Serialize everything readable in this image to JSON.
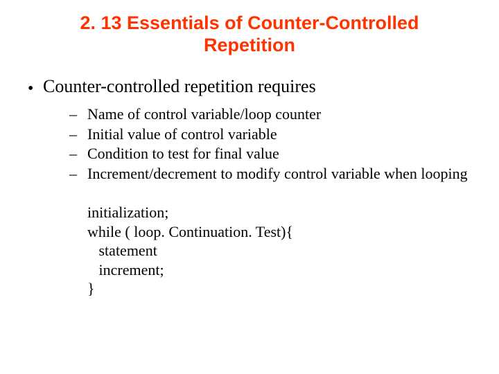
{
  "title": "2. 13  Essentials of Counter-Controlled Repetition",
  "intro": "Counter-controlled repetition requires",
  "bullets": [
    "Name of control variable/loop counter",
    "Initial value of control variable",
    "Condition to test for final value",
    "Increment/decrement to modify control variable when looping"
  ],
  "code": {
    "l1": "initialization;",
    "l2": "while ( loop. Continuation. Test){",
    "l3": "   statement",
    "l4": "   increment;",
    "l5": "}"
  }
}
